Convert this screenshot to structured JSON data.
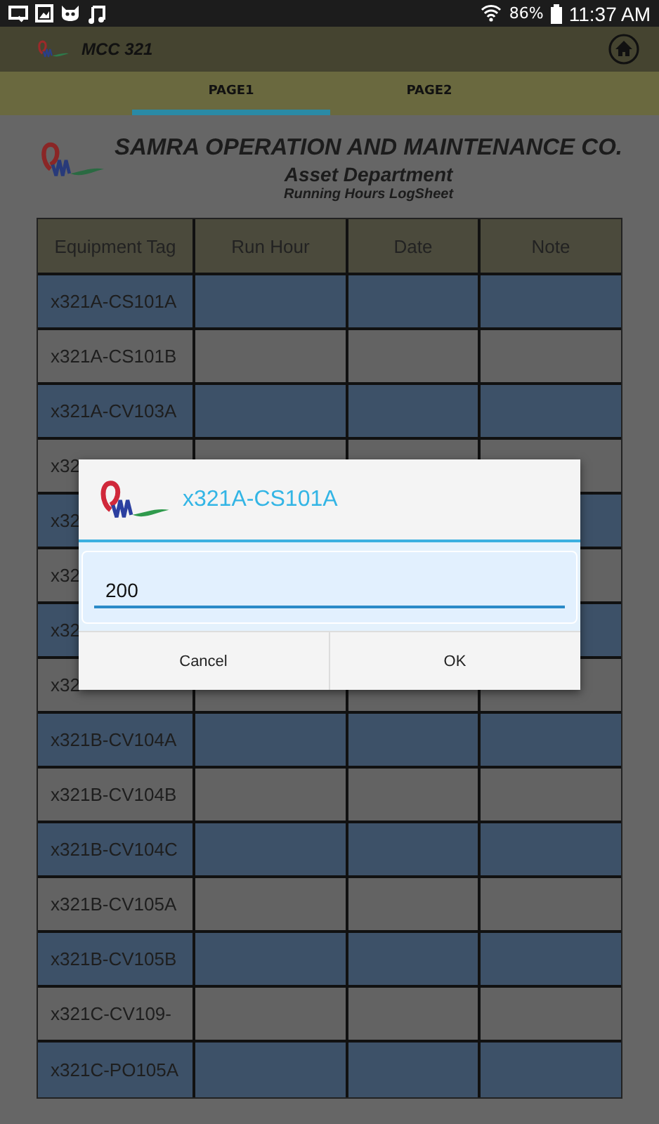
{
  "status_bar": {
    "battery": "86%",
    "time": "11:37 AM"
  },
  "app_bar": {
    "title": "MCC 321"
  },
  "tabs": [
    {
      "label": "PAGE1",
      "selected": true
    },
    {
      "label": "PAGE2",
      "selected": false
    }
  ],
  "header": {
    "company": "SAMRA OPERATION AND MAINTENANCE CO.",
    "department": "Asset Department",
    "sheet": "Running Hours LogSheet"
  },
  "table": {
    "columns": [
      "Equipment Tag",
      "Run Hour",
      "Date",
      "Note"
    ],
    "rows": [
      {
        "tag": "x321A-CS101A"
      },
      {
        "tag": "x321A-CS101B"
      },
      {
        "tag": "x321A-CV103A"
      },
      {
        "tag": "x32"
      },
      {
        "tag": "x32"
      },
      {
        "tag": "x32"
      },
      {
        "tag": "x32"
      },
      {
        "tag": "x32"
      },
      {
        "tag": "x321B-CV104A"
      },
      {
        "tag": "x321B-CV104B"
      },
      {
        "tag": "x321B-CV104C"
      },
      {
        "tag": "x321B-CV105A"
      },
      {
        "tag": "x321B-CV105B"
      },
      {
        "tag": "x321C-CV109-"
      },
      {
        "tag": "x321C-PO105A"
      }
    ]
  },
  "dialog": {
    "title": "x321A-CS101A",
    "value": "200",
    "buttons": [
      "Cancel",
      "OK"
    ]
  }
}
